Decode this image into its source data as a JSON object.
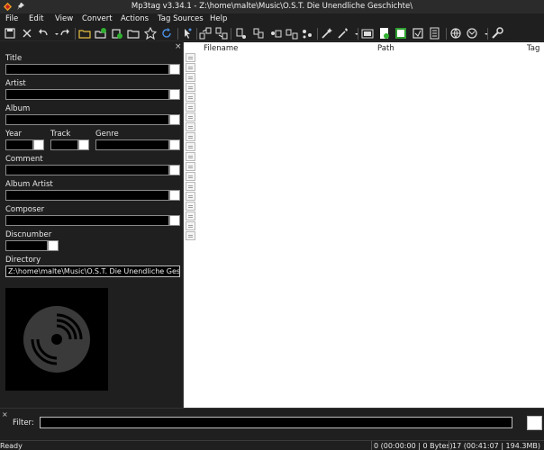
{
  "window": {
    "title": "Mp3tag v3.34.1 - Z:\\home\\malte\\Music\\O.S.T. Die Unendliche Geschichte\\"
  },
  "menu": {
    "file": "File",
    "edit": "Edit",
    "view": "View",
    "convert": "Convert",
    "actions": "Actions",
    "tag_sources": "Tag Sources",
    "help": "Help"
  },
  "toolbar": {
    "icons": [
      "save-icon",
      "remove-tag-icon",
      "undo-icon",
      "redo-icon",
      "change-directory-icon",
      "add-directory-icon",
      "favorites-icon",
      "refresh-icon",
      "select-icon",
      "tag-filename-icon",
      "filename-tag-icon",
      "text-file-tag-icon",
      "filename-filename-icon",
      "auto-numbering-icon",
      "actions-icon",
      "quick-actions-icon",
      "export-icon",
      "cover-web-icon",
      "cover-icon",
      "tag-sources-icon",
      "freedb-icon",
      "options-icon"
    ]
  },
  "tag_panel": {
    "title_label": "Title",
    "artist_label": "Artist",
    "album_label": "Album",
    "year_label": "Year",
    "track_label": "Track",
    "genre_label": "Genre",
    "comment_label": "Comment",
    "album_artist_label": "Album Artist",
    "composer_label": "Composer",
    "discnumber_label": "Discnumber",
    "directory_label": "Directory",
    "directory_value": "Z:\\home\\malte\\Music\\O.S.T. Die Unendliche Geschichte\\"
  },
  "file_list": {
    "columns": [
      "Filename",
      "Path",
      "Tag"
    ],
    "row_count": 19
  },
  "filter": {
    "label": "Filter:",
    "value": ""
  },
  "status": {
    "ready": "Ready",
    "selected": "0 (00:00:00 | 0 Bytes)",
    "total": "17 (00:41:07 | 194.3MB)"
  },
  "colors": {
    "background": "#1f1f1f",
    "field": "#000000",
    "list_bg": "#ffffff"
  }
}
